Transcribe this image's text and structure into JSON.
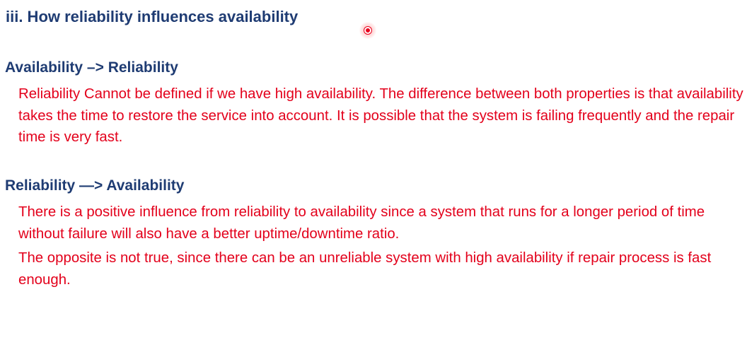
{
  "slide": {
    "title": "iii. How reliability influences availability",
    "sections": [
      {
        "heading": "Availability –> Reliability",
        "paragraphs": [
          "Reliability Cannot be defined if we have high availability. The difference between both properties is that availability takes the time to restore the service into account. It is possible that the system is failing frequently and the repair time is very fast."
        ]
      },
      {
        "heading": "Reliability —> Availability",
        "paragraphs": [
          "There is a positive influence from reliability to availability since a system that runs for a longer period of time without failure will also have a better uptime/downtime ratio.",
          "The opposite is not true, since there can be an unreliable system with high availability if repair process is fast enough."
        ]
      }
    ]
  },
  "colors": {
    "heading": "#1f3c73",
    "body_text": "#e3001b",
    "pointer": "#e8001c"
  },
  "icons": {
    "pointer": "laser-pointer-icon"
  }
}
